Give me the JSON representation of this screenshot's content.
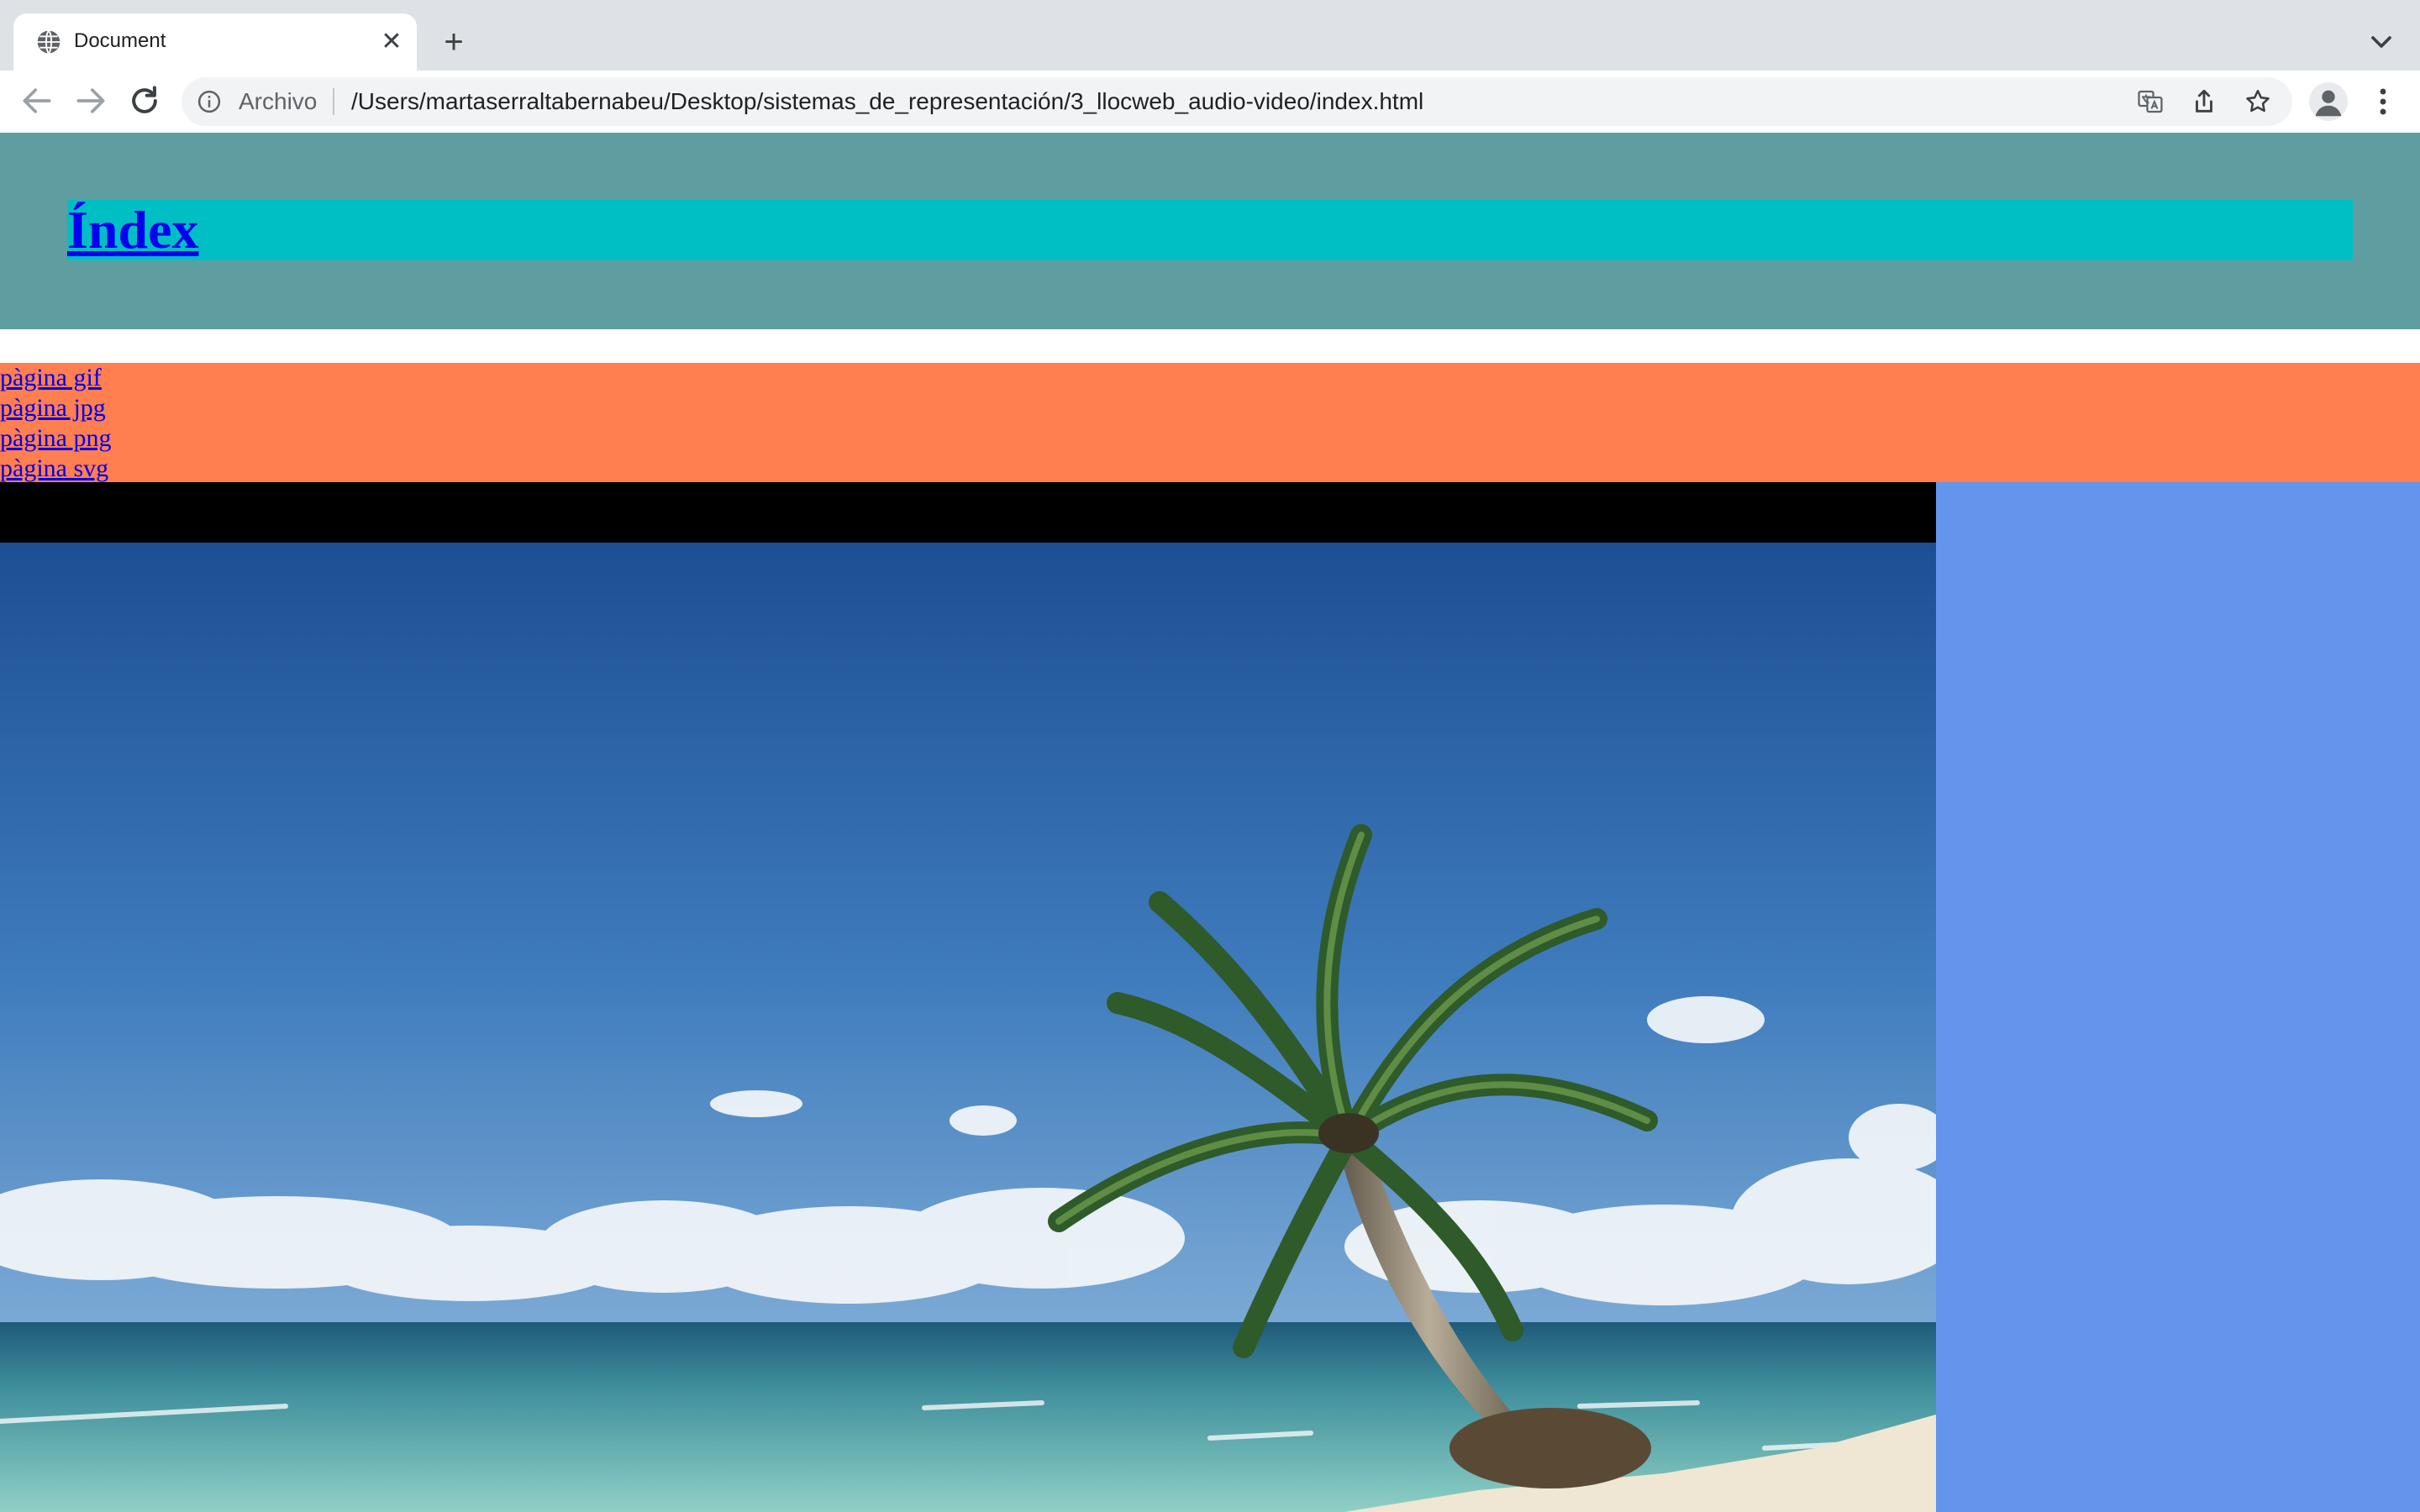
{
  "browser": {
    "tab": {
      "title": "Document",
      "favicon": "globe-icon"
    },
    "toolbar": {
      "security_chip": "Archivo",
      "url": "/Users/martaserraltabernabeu/Desktop/sistemas_de_representación/3_llocweb_audio-video/index.html"
    }
  },
  "page": {
    "header": {
      "title": "Índex"
    },
    "nav": {
      "links": [
        "pàgina gif",
        "pàgina jpg",
        "pàgina png",
        "pàgina svg"
      ]
    },
    "video": {
      "poster": "palm-tree-beach"
    },
    "colors": {
      "header_bg": "#5f9ea0",
      "title_bg": "#00bfc4",
      "nav_bg": "#ff7f50",
      "main_bg": "#6495ed",
      "link": "#0000ee"
    }
  }
}
